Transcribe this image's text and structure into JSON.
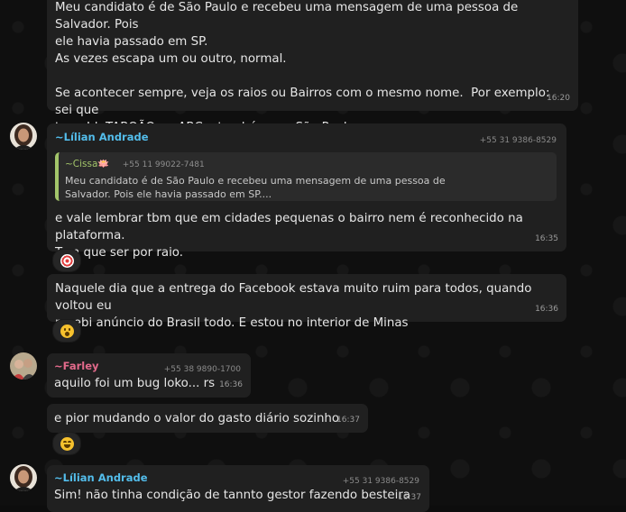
{
  "messages": [
    {
      "text": "Meu candidato é de São Paulo e recebeu uma mensagem de uma pessoa de Salvador. Pois\nele havia passado em SP.\nAs vezes escapa um ou outro, normal.\n\nSe acontecer sempre, veja os raios ou Bairros com o mesmo nome.  Por exemplo: sei que\ntem  Jd. TABOÃO no ABC e também em São Paulo.",
      "time": "16:20"
    },
    {
      "sender": "~Lílian Andrade",
      "phone": "+55 31 9386-8529",
      "quote": {
        "name": "~Cissa🪷",
        "phone": "+55 11 99022-7481",
        "text": "Meu candidato é de São Paulo e recebeu uma mensagem de uma pessoa de\nSalvador. Pois ele havia passado em SP...."
      },
      "text": "e vale lembrar tbm que em cidades pequenas o bairro nem é reconhecido na plataforma.\nTem que ser por raio.",
      "time": "16:35",
      "reaction": "target-emoji"
    },
    {
      "text": "Naquele dia que a entrega do Facebook estava muito ruim para todos, quando voltou eu\nrecebi anúncio do Brasil todo. E estou no interior de Minas",
      "time": "16:36",
      "reaction": "astonished-emoji"
    },
    {
      "sender": "~Farley",
      "phone": "+55 38 9890-1700",
      "text": "aquilo foi um bug loko... rs",
      "time": "16:36"
    },
    {
      "text": "e pior mudando o valor do gasto diário sozinho",
      "time": "16:37",
      "reaction": "laughing-emoji"
    },
    {
      "sender": "~Lílian Andrade",
      "phone": "+55 31 9386-8529",
      "text": "Sim! não tinha condição de tannto gestor fazendo besteira",
      "time": "16:37"
    }
  ],
  "colors": {
    "lilian": "#53bdeb",
    "farley": "#e26a8b",
    "cissa": "#a3c56a",
    "bubble": "#202020"
  }
}
